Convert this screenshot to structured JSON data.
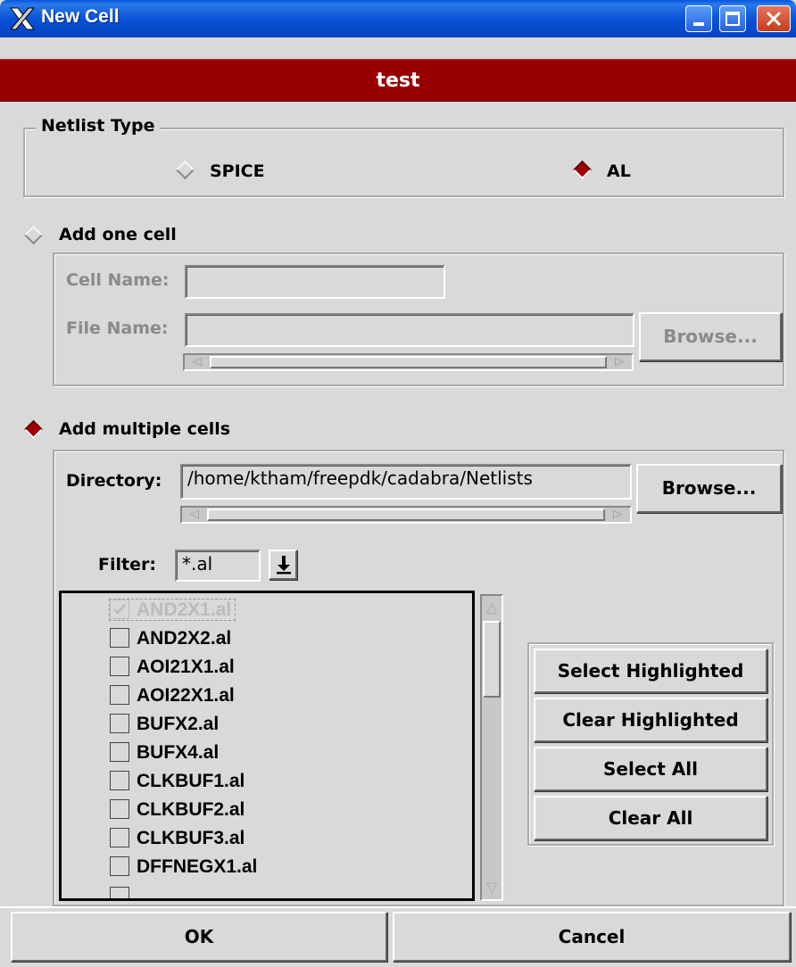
{
  "window": {
    "title": "New Cell"
  },
  "header": {
    "title": "test"
  },
  "netlist_type": {
    "legend": "Netlist Type",
    "options": [
      {
        "label": "SPICE",
        "selected": false
      },
      {
        "label": "AL",
        "selected": true
      }
    ]
  },
  "add_one": {
    "label": "Add one cell",
    "selected": false,
    "cell_name_label": "Cell Name:",
    "cell_name_value": "",
    "file_name_label": "File Name:",
    "file_name_value": "",
    "browse_label": "Browse..."
  },
  "add_multiple": {
    "label": "Add multiple cells",
    "selected": true,
    "directory_label": "Directory:",
    "directory_value": "/home/ktham/freepdk/cadabra/Netlists",
    "browse_label": "Browse...",
    "filter_label": "Filter:",
    "filter_value": "*.al",
    "files": [
      {
        "name": "AND2X1.al",
        "checked": true
      },
      {
        "name": "AND2X2.al",
        "checked": false
      },
      {
        "name": "AOI21X1.al",
        "checked": false
      },
      {
        "name": "AOI22X1.al",
        "checked": false
      },
      {
        "name": "BUFX2.al",
        "checked": false
      },
      {
        "name": "BUFX4.al",
        "checked": false
      },
      {
        "name": "CLKBUF1.al",
        "checked": false
      },
      {
        "name": "CLKBUF2.al",
        "checked": false
      },
      {
        "name": "CLKBUF3.al",
        "checked": false
      },
      {
        "name": "DFFNEGX1.al",
        "checked": false
      }
    ],
    "actions": {
      "select_highlighted": "Select Highlighted",
      "clear_highlighted": "Clear Highlighted",
      "select_all": "Select All",
      "clear_all": "Clear All"
    }
  },
  "footer": {
    "ok": "OK",
    "cancel": "Cancel"
  },
  "colors": {
    "titlebar": "#0a52d6",
    "header": "#960000",
    "radio_on": "#a00000",
    "background": "#d9d9d9"
  }
}
